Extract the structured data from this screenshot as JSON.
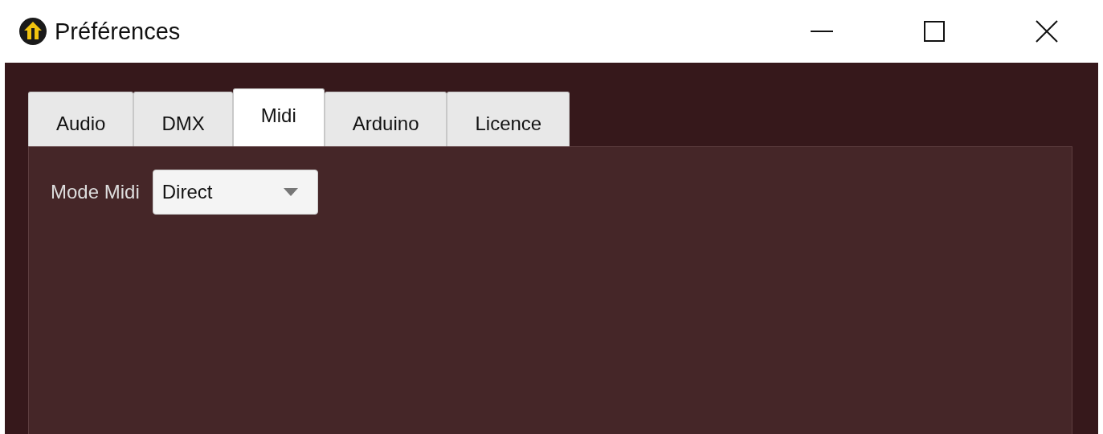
{
  "window": {
    "title": "Préférences"
  },
  "tabs": [
    {
      "label": "Audio",
      "selected": false
    },
    {
      "label": "DMX",
      "selected": false
    },
    {
      "label": "Midi",
      "selected": true
    },
    {
      "label": "Arduino",
      "selected": false
    },
    {
      "label": "Licence",
      "selected": false
    }
  ],
  "midi_mode": {
    "label": "Mode Midi",
    "value": "Direct"
  }
}
